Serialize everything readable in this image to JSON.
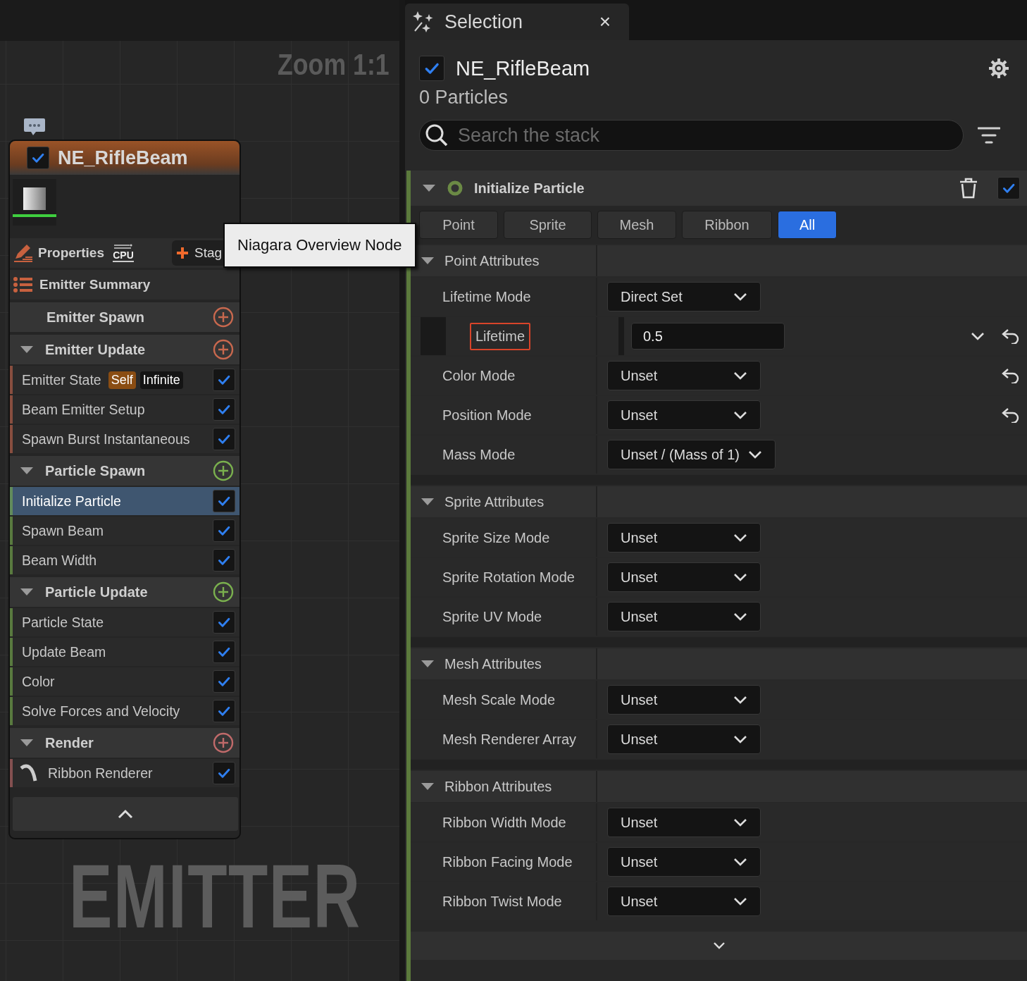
{
  "graph": {
    "zoom_label": "Zoom 1:1",
    "watermark": "EMITTER",
    "tooltip": "Niagara Overview Node",
    "node": {
      "title": "NE_RifleBeam",
      "enabled": true,
      "properties": "Properties",
      "sim_target": "CPU",
      "stage_button": "Stag",
      "summary": "Emitter Summary",
      "groups": [
        {
          "title": "Emitter Spawn",
          "color": "#c8684e"
        },
        {
          "title": "Emitter Update",
          "color": "#c8684e",
          "children": [
            {
              "label": "Emitter State",
              "badges": [
                {
                  "text": "Self",
                  "kind": "scope"
                },
                {
                  "text": "Infinite",
                  "kind": "mode"
                }
              ],
              "checked": true,
              "selected": false
            },
            {
              "label": "Beam Emitter Setup",
              "checked": true,
              "selected": false
            },
            {
              "label": "Spawn Burst Instantaneous",
              "checked": true,
              "selected": false
            }
          ]
        },
        {
          "title": "Particle Spawn",
          "color": "#7ab04e",
          "children": [
            {
              "label": "Initialize Particle",
              "checked": true,
              "selected": true
            },
            {
              "label": "Spawn Beam",
              "checked": true,
              "selected": false
            },
            {
              "label": "Beam Width",
              "checked": true,
              "selected": false
            }
          ]
        },
        {
          "title": "Particle Update",
          "color": "#7ab04e",
          "children": [
            {
              "label": "Particle State",
              "checked": true,
              "selected": false
            },
            {
              "label": "Update Beam",
              "checked": true,
              "selected": false
            },
            {
              "label": "Color",
              "checked": true,
              "selected": false
            },
            {
              "label": "Solve Forces and Velocity",
              "checked": true,
              "selected": false
            }
          ]
        },
        {
          "title": "Render",
          "color": "#c06a6a",
          "children": [
            {
              "label": "Ribbon Renderer",
              "kind": "renderer",
              "checked": true,
              "selected": false
            }
          ]
        }
      ]
    }
  },
  "selection": {
    "tab_title": "Selection",
    "close": "×",
    "emitter": {
      "name": "NE_RifleBeam",
      "enabled": true
    },
    "particles": "0 Particles",
    "search": {
      "placeholder": "Search the stack"
    },
    "module": {
      "title": "Initialize Particle",
      "enabled": true
    },
    "filters": [
      {
        "label": "Point",
        "selected": false
      },
      {
        "label": "Sprite",
        "selected": false
      },
      {
        "label": "Mesh",
        "selected": false
      },
      {
        "label": "Ribbon",
        "selected": false
      },
      {
        "label": "All",
        "selected": true
      }
    ],
    "sections": [
      {
        "title": "Point Attributes",
        "rows": [
          {
            "label": "Lifetime Mode",
            "kind": "dropdown",
            "value": "Direct Set",
            "resettable": false,
            "highlighted": false
          },
          {
            "label": "Lifetime",
            "kind": "number",
            "value": "0.5",
            "resettable": true,
            "highlighted": true
          },
          {
            "label": "Color Mode",
            "kind": "dropdown",
            "value": "Unset",
            "resettable": true,
            "highlighted": false
          },
          {
            "label": "Position Mode",
            "kind": "dropdown",
            "value": "Unset",
            "resettable": true,
            "highlighted": false
          },
          {
            "label": "Mass Mode",
            "kind": "dropdown",
            "value": "Unset / (Mass of 1)",
            "resettable": false,
            "highlighted": false
          }
        ]
      },
      {
        "title": "Sprite Attributes",
        "rows": [
          {
            "label": "Sprite Size Mode",
            "kind": "dropdown",
            "value": "Unset",
            "resettable": false,
            "highlighted": false
          },
          {
            "label": "Sprite Rotation Mode",
            "kind": "dropdown",
            "value": "Unset",
            "resettable": false,
            "highlighted": false
          },
          {
            "label": "Sprite UV Mode",
            "kind": "dropdown",
            "value": "Unset",
            "resettable": false,
            "highlighted": false
          }
        ]
      },
      {
        "title": "Mesh Attributes",
        "rows": [
          {
            "label": "Mesh Scale Mode",
            "kind": "dropdown",
            "value": "Unset",
            "resettable": false,
            "highlighted": false
          },
          {
            "label": "Mesh Renderer Array",
            "kind": "dropdown",
            "value": "Unset",
            "resettable": false,
            "highlighted": false
          }
        ]
      },
      {
        "title": "Ribbon Attributes",
        "rows": [
          {
            "label": "Ribbon Width Mode",
            "kind": "dropdown",
            "value": "Unset",
            "resettable": false,
            "highlighted": false
          },
          {
            "label": "Ribbon Facing Mode",
            "kind": "dropdown",
            "value": "Unset",
            "resettable": false,
            "highlighted": false
          },
          {
            "label": "Ribbon Twist Mode",
            "kind": "dropdown",
            "value": "Unset",
            "resettable": false,
            "highlighted": false
          }
        ]
      }
    ]
  }
}
